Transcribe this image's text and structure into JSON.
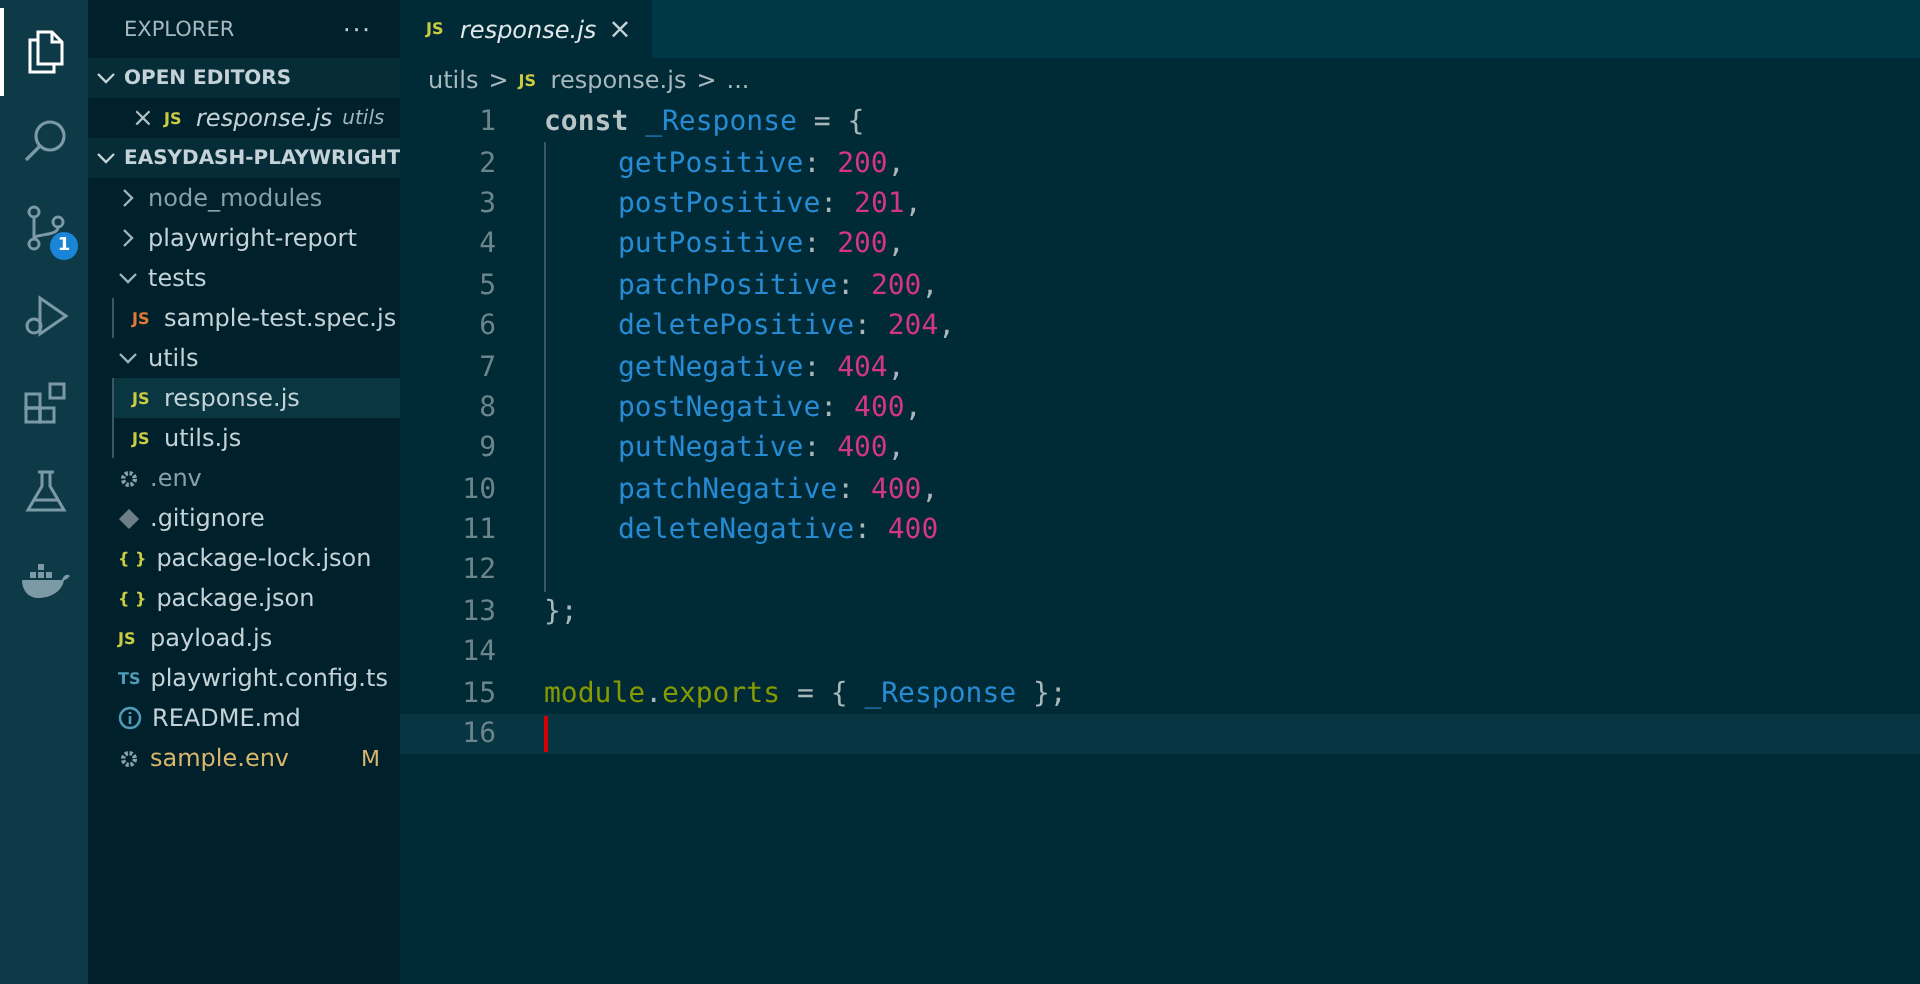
{
  "activity_bar": [
    {
      "kind": "files",
      "selected": true
    },
    {
      "kind": "search",
      "selected": false
    },
    {
      "kind": "source_control",
      "selected": false,
      "badge": "1"
    },
    {
      "kind": "run",
      "selected": false
    },
    {
      "kind": "extensions",
      "selected": false
    },
    {
      "kind": "flask",
      "selected": false
    },
    {
      "kind": "whale",
      "selected": false
    }
  ],
  "sidebar": {
    "title": "EXPLORER",
    "more": "···",
    "open_editors": {
      "title": "OPEN EDITORS",
      "expanded": true,
      "items": [
        {
          "close": "×",
          "icon": "JS",
          "name": "response.js",
          "folder": "utils"
        }
      ]
    },
    "project": {
      "title": "EASYDASH-PLAYWRIGHT",
      "expanded": true,
      "items": [
        {
          "name": "node_modules",
          "kind": "folder",
          "expanded": false,
          "dimmed": true,
          "selected": false
        },
        {
          "name": "playwright-report",
          "kind": "folder",
          "expanded": false,
          "dimmed": false,
          "selected": false
        },
        {
          "name": "tests",
          "kind": "folder",
          "expanded": true,
          "dimmed": false,
          "selected": false,
          "children": [
            {
              "name": "sample-test.spec.js",
              "kind": "file",
              "icon": "JS",
              "color": "#e37933",
              "dimmed": false,
              "selected": false
            }
          ]
        },
        {
          "name": "utils",
          "kind": "folder",
          "expanded": true,
          "dimmed": false,
          "selected": false,
          "children": [
            {
              "name": "response.js",
              "kind": "file",
              "icon": "JS",
              "color": "#cbcb41",
              "dimmed": false,
              "selected": true
            },
            {
              "name": "utils.js",
              "kind": "file",
              "icon": "JS",
              "color": "#cbcb41",
              "dimmed": false,
              "selected": false
            }
          ]
        },
        {
          "name": ".env",
          "kind": "gear",
          "dimmed": true,
          "selected": false
        },
        {
          "name": ".gitignore",
          "kind": "git",
          "dimmed": false,
          "selected": false
        },
        {
          "name": "package-lock.json",
          "kind": "file",
          "icon": "{ }",
          "color": "#cbcb41",
          "dimmed": false,
          "selected": false
        },
        {
          "name": "package.json",
          "kind": "file",
          "icon": "{ }",
          "color": "#cbcb41",
          "dimmed": false,
          "selected": false
        },
        {
          "name": "payload.js",
          "kind": "file",
          "icon": "JS",
          "color": "#cbcb41",
          "dimmed": false,
          "selected": false
        },
        {
          "name": "playwright.config.ts",
          "kind": "file",
          "icon": "TS",
          "color": "#519aba",
          "dimmed": false,
          "selected": false
        },
        {
          "name": "README.md",
          "kind": "info",
          "dimmed": false,
          "selected": false
        },
        {
          "name": "sample.env",
          "kind": "gear",
          "dimmed": false,
          "selected": false,
          "modified": true,
          "badge": "M"
        }
      ]
    }
  },
  "tabs": [
    {
      "icon": "JS",
      "title": "response.js",
      "close": "×",
      "selected": true
    }
  ],
  "breadcrumb": [
    {
      "text": "utils"
    },
    {
      "text": ">"
    },
    {
      "icon": "JS",
      "text": "response.js"
    },
    {
      "text": ">"
    },
    {
      "text": "..."
    }
  ],
  "code": [
    {
      "number": "1",
      "indented": false,
      "current": false,
      "tokens": [
        {
          "text": "const ",
          "kind": "keyword"
        },
        {
          "text": "_Response",
          "kind": "var"
        },
        {
          "text": " = {",
          "kind": "punct"
        }
      ]
    },
    {
      "number": "2",
      "indented": true,
      "current": false,
      "tokens": [
        {
          "text": "getPositive",
          "kind": "var"
        },
        {
          "text": ": ",
          "kind": "punct"
        },
        {
          "text": "200",
          "kind": "number"
        },
        {
          "text": ",",
          "kind": "punct"
        }
      ]
    },
    {
      "number": "3",
      "indented": true,
      "current": false,
      "tokens": [
        {
          "text": "postPositive",
          "kind": "var"
        },
        {
          "text": ": ",
          "kind": "punct"
        },
        {
          "text": "201",
          "kind": "number"
        },
        {
          "text": ",",
          "kind": "punct"
        }
      ]
    },
    {
      "number": "4",
      "indented": true,
      "current": false,
      "tokens": [
        {
          "text": "putPositive",
          "kind": "var"
        },
        {
          "text": ": ",
          "kind": "punct"
        },
        {
          "text": "200",
          "kind": "number"
        },
        {
          "text": ",",
          "kind": "punct"
        }
      ]
    },
    {
      "number": "5",
      "indented": true,
      "current": false,
      "tokens": [
        {
          "text": "patchPositive",
          "kind": "var"
        },
        {
          "text": ": ",
          "kind": "punct"
        },
        {
          "text": "200",
          "kind": "number"
        },
        {
          "text": ",",
          "kind": "punct"
        }
      ]
    },
    {
      "number": "6",
      "indented": true,
      "current": false,
      "tokens": [
        {
          "text": "deletePositive",
          "kind": "var"
        },
        {
          "text": ": ",
          "kind": "punct"
        },
        {
          "text": "204",
          "kind": "number"
        },
        {
          "text": ",",
          "kind": "punct"
        }
      ]
    },
    {
      "number": "7",
      "indented": true,
      "current": false,
      "tokens": [
        {
          "text": "getNegative",
          "kind": "var"
        },
        {
          "text": ": ",
          "kind": "punct"
        },
        {
          "text": "404",
          "kind": "number"
        },
        {
          "text": ",",
          "kind": "punct"
        }
      ]
    },
    {
      "number": "8",
      "indented": true,
      "current": false,
      "tokens": [
        {
          "text": "postNegative",
          "kind": "var"
        },
        {
          "text": ": ",
          "kind": "punct"
        },
        {
          "text": "400",
          "kind": "number"
        },
        {
          "text": ",",
          "kind": "punct"
        }
      ]
    },
    {
      "number": "9",
      "indented": true,
      "current": false,
      "tokens": [
        {
          "text": "putNegative",
          "kind": "var"
        },
        {
          "text": ": ",
          "kind": "punct"
        },
        {
          "text": "400",
          "kind": "number"
        },
        {
          "text": ",",
          "kind": "punct"
        }
      ]
    },
    {
      "number": "10",
      "indented": true,
      "current": false,
      "tokens": [
        {
          "text": "patchNegative",
          "kind": "var"
        },
        {
          "text": ": ",
          "kind": "punct"
        },
        {
          "text": "400",
          "kind": "number"
        },
        {
          "text": ",",
          "kind": "punct"
        }
      ]
    },
    {
      "number": "11",
      "indented": true,
      "current": false,
      "tokens": [
        {
          "text": "deleteNegative",
          "kind": "var"
        },
        {
          "text": ": ",
          "kind": "punct"
        },
        {
          "text": "400",
          "kind": "number"
        }
      ]
    },
    {
      "number": "12",
      "indented": true,
      "current": false
    },
    {
      "number": "13",
      "indented": false,
      "current": false,
      "tokens": [
        {
          "text": "};",
          "kind": "punct"
        }
      ]
    },
    {
      "number": "14",
      "indented": false,
      "current": false
    },
    {
      "number": "15",
      "indented": false,
      "current": false,
      "tokens": [
        {
          "text": "module",
          "kind": "module"
        },
        {
          "text": ".",
          "kind": "punct"
        },
        {
          "text": "exports",
          "kind": "module"
        },
        {
          "text": " = { ",
          "kind": "punct"
        },
        {
          "text": "_Response",
          "kind": "var"
        },
        {
          "text": " };",
          "kind": "punct"
        }
      ]
    },
    {
      "number": "16",
      "indented": false,
      "current": true
    }
  ]
}
